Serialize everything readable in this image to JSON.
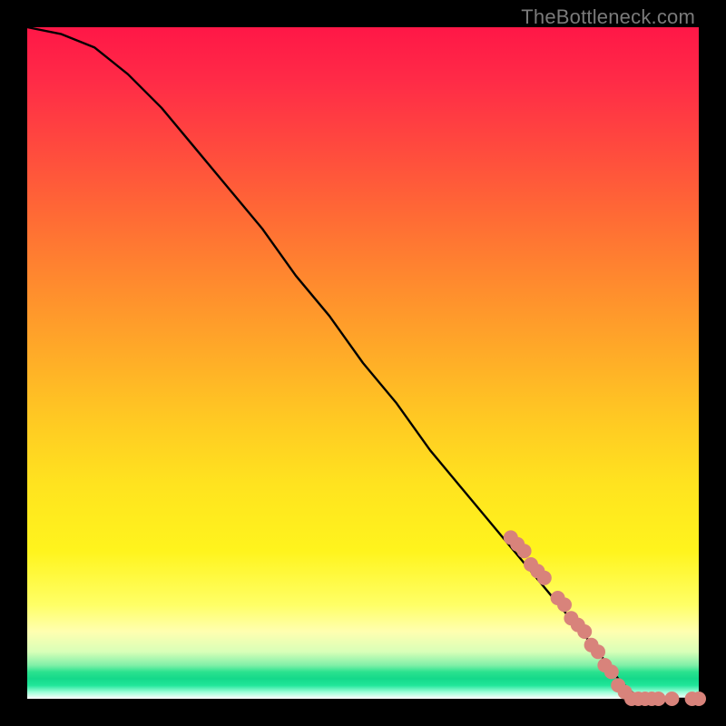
{
  "watermark": "TheBottleneck.com",
  "chart_data": {
    "type": "line",
    "title": "",
    "xlabel": "",
    "ylabel": "",
    "xlim": [
      0,
      100
    ],
    "ylim": [
      0,
      100
    ],
    "grid": false,
    "background_gradient": [
      "#ff1747",
      "#ff6a35",
      "#ffe31f",
      "#ffffb0",
      "#2be28f",
      "#ffffff"
    ],
    "series": [
      {
        "name": "bottleneck-curve",
        "color": "#000000",
        "x": [
          0,
          5,
          10,
          15,
          20,
          25,
          30,
          35,
          40,
          45,
          50,
          55,
          60,
          65,
          70,
          75,
          80,
          85,
          88,
          90,
          92,
          94,
          96,
          98,
          100
        ],
        "y": [
          100,
          99,
          97,
          93,
          88,
          82,
          76,
          70,
          63,
          57,
          50,
          44,
          37,
          31,
          25,
          19,
          13,
          7,
          3,
          1,
          0,
          0,
          0,
          0,
          0
        ]
      }
    ],
    "markers": {
      "name": "highlight-points",
      "color": "#d8837b",
      "points": [
        {
          "x": 72,
          "y": 24
        },
        {
          "x": 73,
          "y": 23
        },
        {
          "x": 74,
          "y": 22
        },
        {
          "x": 75,
          "y": 20
        },
        {
          "x": 76,
          "y": 19
        },
        {
          "x": 77,
          "y": 18
        },
        {
          "x": 79,
          "y": 15
        },
        {
          "x": 80,
          "y": 14
        },
        {
          "x": 81,
          "y": 12
        },
        {
          "x": 82,
          "y": 11
        },
        {
          "x": 83,
          "y": 10
        },
        {
          "x": 84,
          "y": 8
        },
        {
          "x": 85,
          "y": 7
        },
        {
          "x": 86,
          "y": 5
        },
        {
          "x": 87,
          "y": 4
        },
        {
          "x": 88,
          "y": 2
        },
        {
          "x": 89,
          "y": 1
        },
        {
          "x": 90,
          "y": 0
        },
        {
          "x": 91,
          "y": 0
        },
        {
          "x": 92,
          "y": 0
        },
        {
          "x": 93,
          "y": 0
        },
        {
          "x": 94,
          "y": 0
        },
        {
          "x": 96,
          "y": 0
        },
        {
          "x": 99,
          "y": 0
        },
        {
          "x": 100,
          "y": 0
        }
      ]
    }
  }
}
